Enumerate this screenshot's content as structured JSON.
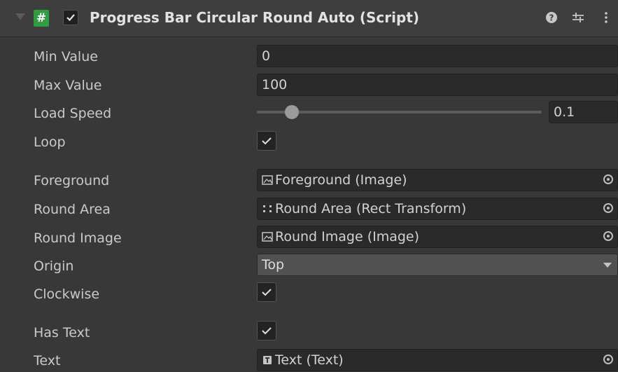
{
  "component": {
    "title": "Progress Bar Circular Round Auto (Script)",
    "enabled": true,
    "script_icon": "#",
    "header_icons": [
      "help-icon",
      "presets-icon",
      "more-icon"
    ]
  },
  "fields": {
    "min_value": {
      "label": "Min Value",
      "value": "0"
    },
    "max_value": {
      "label": "Max Value",
      "value": "100"
    },
    "load_speed": {
      "label": "Load Speed",
      "value": "0.1",
      "slider_fraction": 0.1
    },
    "loop": {
      "label": "Loop",
      "checked": true
    },
    "foreground": {
      "label": "Foreground",
      "value": "Foreground (Image)",
      "icon": "image-icon"
    },
    "round_area": {
      "label": "Round Area",
      "value": "Round Area (Rect Transform)",
      "icon": "rect-transform-icon"
    },
    "round_image": {
      "label": "Round Image",
      "value": "Round Image (Image)",
      "icon": "image-icon"
    },
    "origin": {
      "label": "Origin",
      "value": "Top"
    },
    "clockwise": {
      "label": "Clockwise",
      "checked": true
    },
    "has_text": {
      "label": "Has Text",
      "checked": true
    },
    "text": {
      "label": "Text",
      "value": "Text (Text)",
      "icon": "text-icon"
    }
  }
}
